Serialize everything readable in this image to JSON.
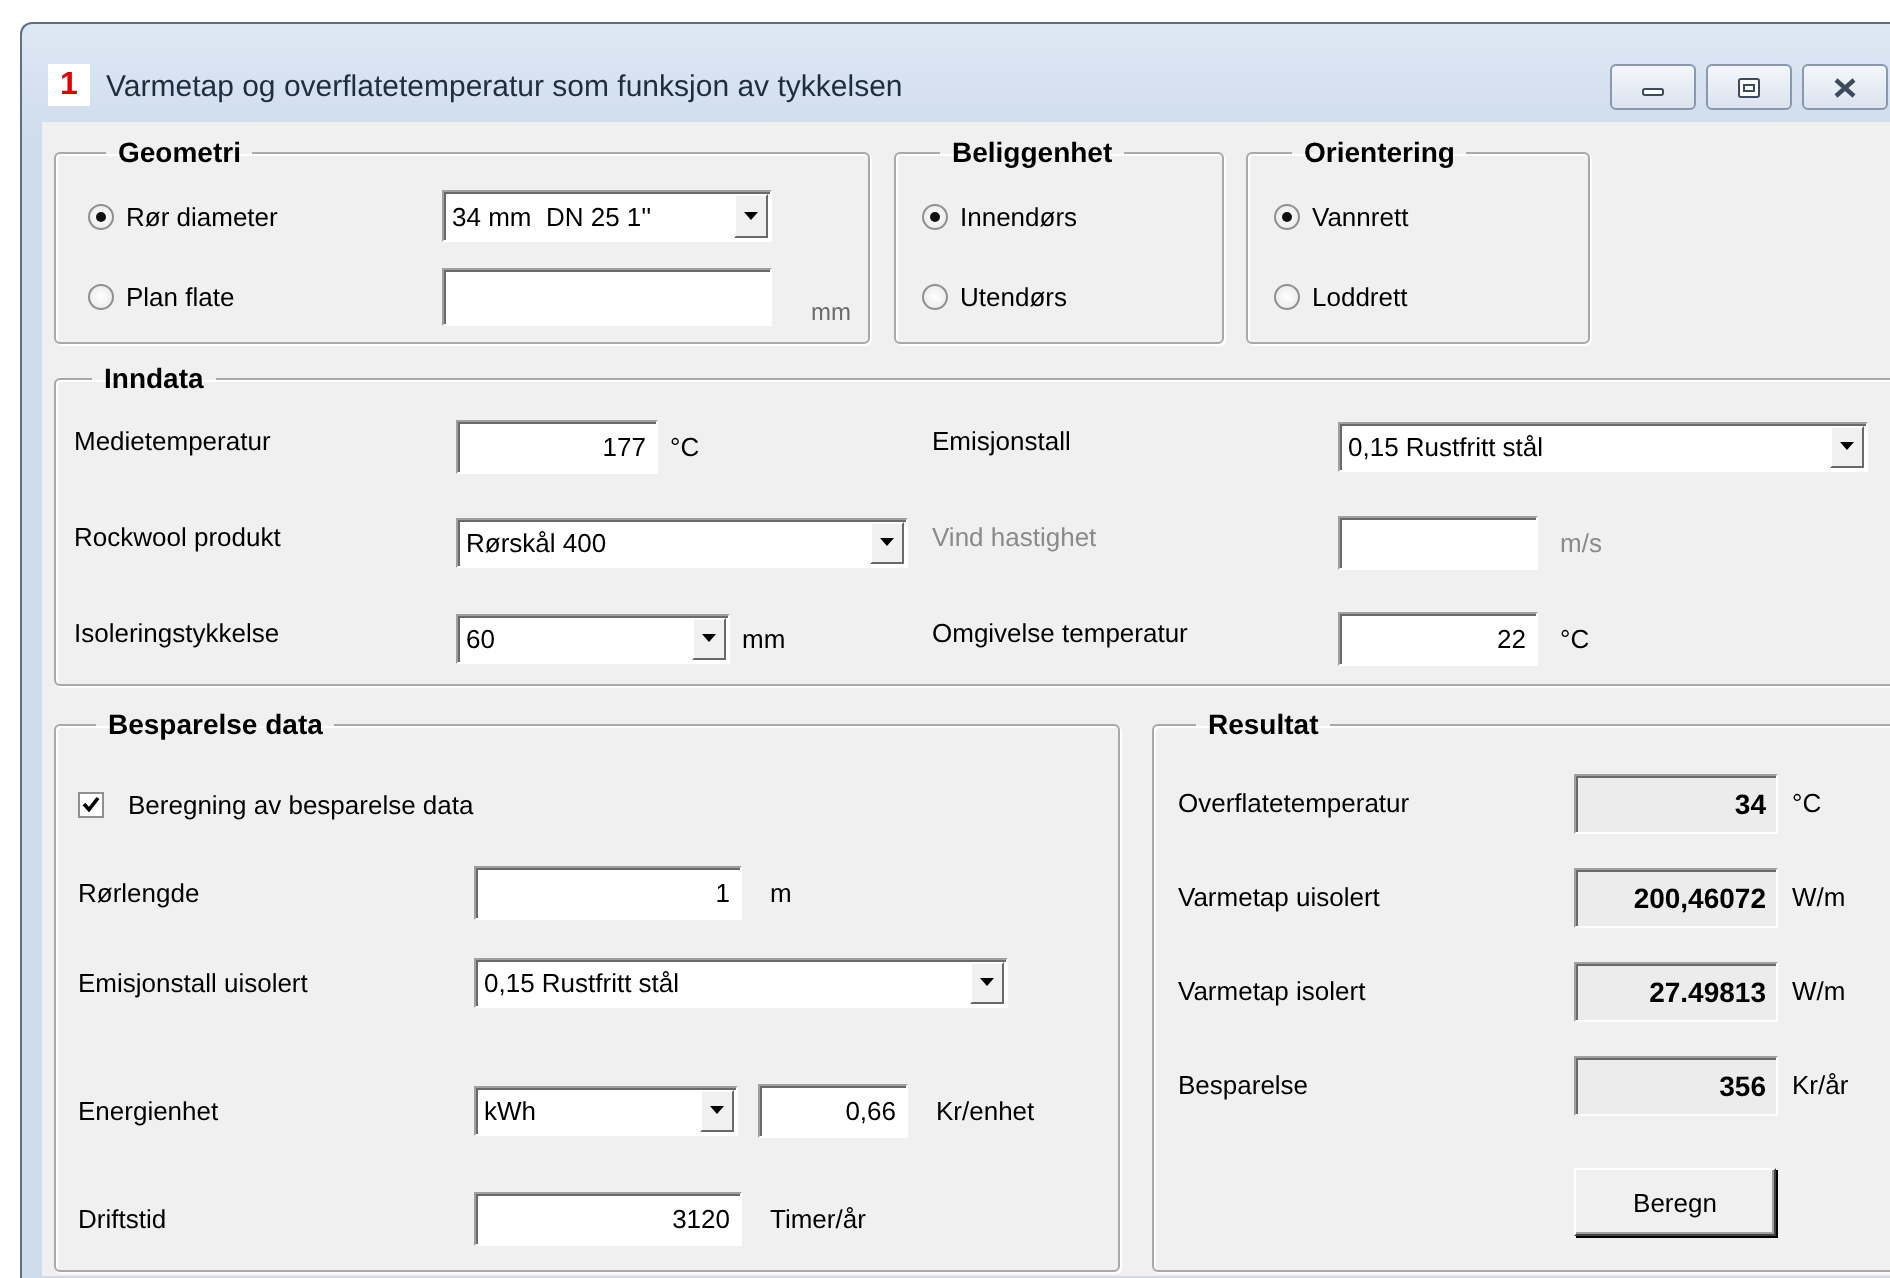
{
  "window": {
    "icon_text": "1",
    "title": "Varmetap og overflatetemperatur som funksjon av tykkelsen"
  },
  "geometri": {
    "title": "Geometri",
    "options": [
      {
        "label": "Rør diameter",
        "selected": true,
        "kind": "combo",
        "value": "34 mm  DN 25 1''"
      },
      {
        "label": "Plan flate",
        "selected": false,
        "kind": "text",
        "unit": "mm"
      }
    ]
  },
  "beliggenhet": {
    "title": "Beliggenhet",
    "options": [
      {
        "label": "Innendørs",
        "selected": true
      },
      {
        "label": "Utendørs",
        "selected": false
      }
    ]
  },
  "orientering": {
    "title": "Orientering",
    "options": [
      {
        "label": "Vannrett",
        "selected": true
      },
      {
        "label": "Loddrett",
        "selected": false
      }
    ]
  },
  "inndata": {
    "title": "Inndata",
    "left_fields": [
      {
        "label": "Medietemperatur",
        "kind": "text",
        "value": "177",
        "unit": "°C",
        "disabled": false
      },
      {
        "label": "Rockwool produkt",
        "kind": "combo",
        "value": "Rørskål 400",
        "disabled": false
      },
      {
        "label": "Isoleringstykkelse",
        "kind": "combo",
        "value": "60",
        "unit": "mm",
        "disabled": false
      }
    ],
    "right_fields": [
      {
        "label": "Emisjonstall",
        "kind": "combo",
        "value": "0,15 Rustfritt stål",
        "disabled": false
      },
      {
        "label": "Vind hastighet",
        "kind": "text",
        "unit": "m/s",
        "disabled": true
      },
      {
        "label": "Omgivelse temperatur",
        "kind": "text",
        "value": "22",
        "unit": "°C",
        "disabled": false
      }
    ]
  },
  "besparelse": {
    "title": "Besparelse data",
    "checkbox": {
      "label": "Beregning av besparelse data",
      "checked": true
    },
    "fields": [
      {
        "label": "Rørlengde",
        "kind": "text",
        "value": "1",
        "unit": "m"
      },
      {
        "label": "Emisjonstall uisolert",
        "kind": "combo",
        "value": "0,15 Rustfritt stål"
      },
      {
        "label": "Energienhet",
        "kind": "combo_price",
        "value": "kWh",
        "price": "0,66",
        "unit": "Kr/enhet"
      },
      {
        "label": "Driftstid",
        "kind": "text",
        "value": "3120",
        "unit": "Timer/år"
      }
    ]
  },
  "resultat": {
    "title": "Resultat",
    "rows": [
      {
        "label": "Overflatetemperatur",
        "value": "34",
        "unit": "°C"
      },
      {
        "label": "Varmetap uisolert",
        "value": "200,46072",
        "unit": "W/m"
      },
      {
        "label": "Varmetap isolert",
        "value": "27.49813",
        "unit": "W/m"
      },
      {
        "label": "Besparelse",
        "value": "356",
        "unit": "Kr/år"
      }
    ],
    "button": "Beregn"
  }
}
